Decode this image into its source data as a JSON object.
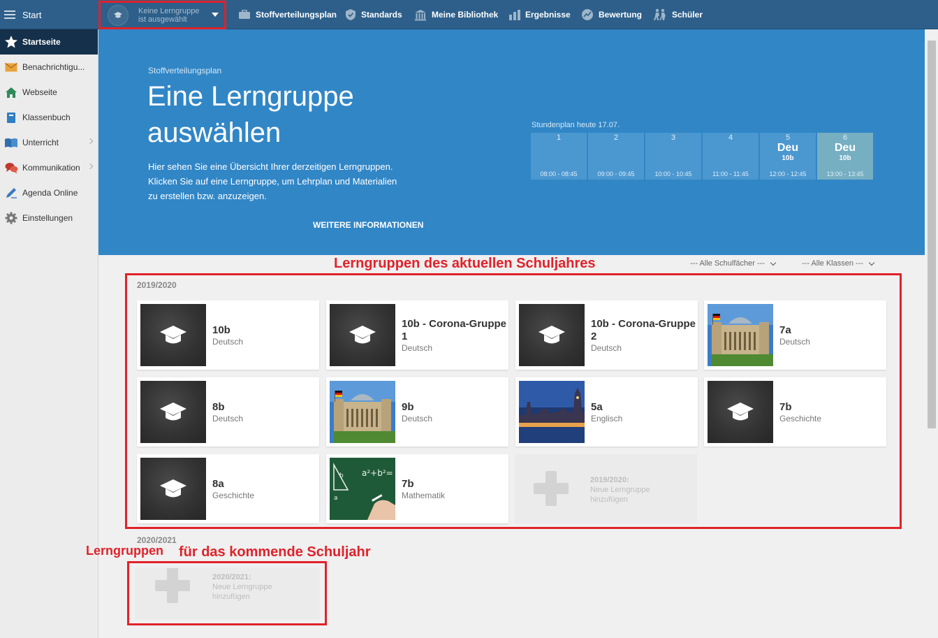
{
  "topbar": {
    "start_label": "Start",
    "group_selector": {
      "line1": "Keine Lerngruppe",
      "line2": "ist ausgewählt"
    },
    "nav": [
      {
        "label": "Stoffverteilungsplan",
        "icon": "briefcase-icon"
      },
      {
        "label": "Standards",
        "icon": "shield-check-icon"
      },
      {
        "label": "Meine Bibliothek",
        "icon": "library-icon"
      },
      {
        "label": "Ergebnisse",
        "icon": "bar-chart-icon"
      },
      {
        "label": "Bewertung",
        "icon": "grade-chart-icon"
      },
      {
        "label": "Schüler",
        "icon": "students-icon"
      }
    ]
  },
  "sidebar": {
    "items": [
      {
        "label": "Startseite",
        "icon": "star-icon"
      },
      {
        "label": "Benachrichtigu...",
        "icon": "envelope-icon"
      },
      {
        "label": "Webseite",
        "icon": "home-icon"
      },
      {
        "label": "Klassenbuch",
        "icon": "book-icon"
      },
      {
        "label": "Unterricht",
        "icon": "open-book-icon"
      },
      {
        "label": "Kommunikation",
        "icon": "chat-icon"
      },
      {
        "label": "Agenda Online",
        "icon": "pen-icon"
      },
      {
        "label": "Einstellungen",
        "icon": "gear-icon"
      }
    ]
  },
  "hero": {
    "subtitle": "Stoffverteilungsplan",
    "title_line1": "Eine Lerngruppe",
    "title_line2": "auswählen",
    "desc1": "Hier sehen Sie eine Übersicht Ihrer derzeitigen Lerngruppen.",
    "desc2": "Klicken Sie auf eine Lerngruppe, um Lehrplan und Materialien",
    "desc3": "zu erstellen bzw. anzuzeigen.",
    "link": "WEITERE INFORMATIONEN"
  },
  "timetable": {
    "title": "Stundenplan heute 17.07.",
    "slots": [
      {
        "num": "1",
        "subject": "",
        "class": "",
        "time": "08:00 - 08:45"
      },
      {
        "num": "2",
        "subject": "",
        "class": "",
        "time": "09:00 - 09:45"
      },
      {
        "num": "3",
        "subject": "",
        "class": "",
        "time": "10:00 - 10:45"
      },
      {
        "num": "4",
        "subject": "",
        "class": "",
        "time": "11:00 - 11:45"
      },
      {
        "num": "5",
        "subject": "Deu",
        "class": "10b",
        "time": "12:00 - 12:45"
      },
      {
        "num": "6",
        "subject": "Deu",
        "class": "10b",
        "time": "13:00 - 13:45"
      }
    ]
  },
  "annotations": {
    "current": "Lerngruppen des aktuellen Schuljahres",
    "next_a": "Lerngruppen",
    "next_b": "für das kommende Schuljahr"
  },
  "filters": {
    "subjects": "--- Alle Schulfächer ---",
    "classes": "--- Alle Klassen ---"
  },
  "years": {
    "current": "2019/2020",
    "next": "2020/2021"
  },
  "groups": [
    {
      "name": "10b",
      "subject": "Deutsch",
      "image": "chalkboard"
    },
    {
      "name": "10b - Corona-Gruppe 1",
      "subject": "Deutsch",
      "image": "chalkboard"
    },
    {
      "name": "10b - Corona-Gruppe 2",
      "subject": "Deutsch",
      "image": "chalkboard"
    },
    {
      "name": "7a",
      "subject": "Deutsch",
      "image": "reichstag"
    },
    {
      "name": "8b",
      "subject": "Deutsch",
      "image": "chalkboard"
    },
    {
      "name": "9b",
      "subject": "Deutsch",
      "image": "reichstag"
    },
    {
      "name": "5a",
      "subject": "Englisch",
      "image": "westminster"
    },
    {
      "name": "7b",
      "subject": "Geschichte",
      "image": "chalkboard"
    },
    {
      "name": "8a",
      "subject": "Geschichte",
      "image": "chalkboard"
    },
    {
      "name": "7b",
      "subject": "Mathematik",
      "image": "math-board"
    }
  ],
  "add_current": {
    "line1": "2019/2020:",
    "line2": "Neue Lerngruppe",
    "line3": "hinzufügen"
  },
  "add_next": {
    "line1": "2020/2021:",
    "line2": "Neue Lerngruppe",
    "line3": "hinzufügen"
  },
  "colors": {
    "topbar": "#2d5f8a",
    "hero": "#3186c6",
    "annotation": "#e0222a"
  }
}
